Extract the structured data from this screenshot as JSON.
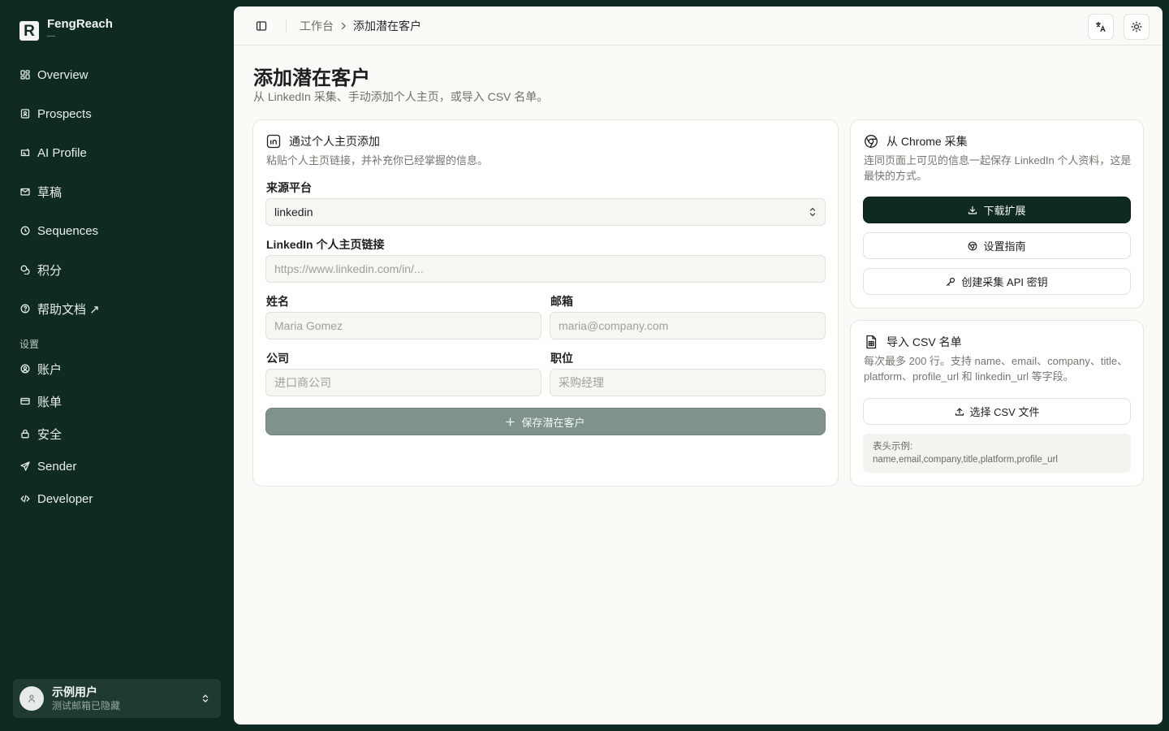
{
  "sidebar": {
    "brand": {
      "name": "FengReach",
      "sub": "—",
      "logo_letter": "R"
    },
    "nav": [
      {
        "label": "Overview",
        "icon": "grid-icon"
      },
      {
        "label": "Prospects",
        "icon": "contact-book-icon"
      },
      {
        "label": "AI Profile",
        "icon": "ai-profile-icon"
      },
      {
        "label": "草稿",
        "icon": "mail-draft-icon"
      },
      {
        "label": "Sequences",
        "icon": "clock-icon"
      },
      {
        "label": "积分",
        "icon": "coins-icon"
      },
      {
        "label": "帮助文档 ↗",
        "icon": "help-circle-icon"
      }
    ],
    "settings_heading": "设置",
    "settings": [
      {
        "label": "账户",
        "icon": "user-circle-icon"
      },
      {
        "label": "账单",
        "icon": "credit-card-icon"
      },
      {
        "label": "安全",
        "icon": "lock-icon"
      },
      {
        "label": "Sender",
        "icon": "send-icon"
      },
      {
        "label": "Developer",
        "icon": "code-icon"
      }
    ],
    "user": {
      "name": "示例用户",
      "email": "测试邮箱已隐藏"
    }
  },
  "topbar": {
    "breadcrumb": [
      "工作台",
      "添加潜在客户"
    ]
  },
  "page": {
    "title": "添加潜在客户",
    "subtitle": "从 LinkedIn 采集、手动添加个人主页，或导入 CSV 名单。"
  },
  "profile_form": {
    "title": "通过个人主页添加",
    "description": "粘贴个人主页链接，并补充你已经掌握的信息。",
    "platform_label": "来源平台",
    "platform_value": "linkedin",
    "url_label": "LinkedIn 个人主页链接",
    "url_placeholder": "https://www.linkedin.com/in/...",
    "name_label": "姓名",
    "name_placeholder": "Maria Gomez",
    "email_label": "邮箱",
    "email_placeholder": "maria@company.com",
    "company_label": "公司",
    "company_placeholder": "进口商公司",
    "title_label": "职位",
    "title_placeholder": "采购经理",
    "save_label": "保存潜在客户"
  },
  "chrome_card": {
    "title": "从 Chrome 采集",
    "description": "连同页面上可见的信息一起保存 LinkedIn 个人资料，这是最快的方式。",
    "download_label": "下载扩展",
    "guide_label": "设置指南",
    "api_key_label": "创建采集 API 密钥"
  },
  "csv_card": {
    "title": "导入 CSV 名单",
    "description": "每次最多 200 行。支持 name、email、company、title、platform、profile_url 和 linkedin_url 等字段。",
    "choose_label": "选择 CSV 文件",
    "example_heading": "表头示例:",
    "example_value": "name,email,company,title,platform,profile_url"
  },
  "colors": {
    "sidebar_bg": "#0f2a22",
    "main_bg": "#fafaf7",
    "primary": "#0f2a22",
    "save_disabled": "#7f928b"
  }
}
